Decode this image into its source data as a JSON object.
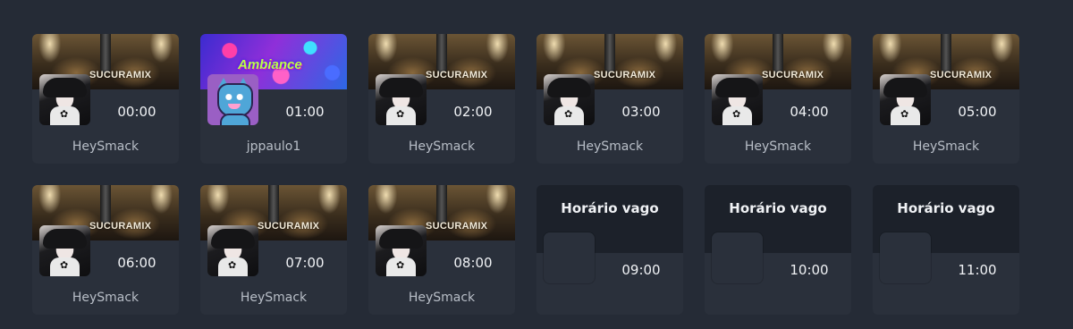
{
  "slots": [
    {
      "time": "00:00",
      "user": "HeySmack",
      "banner": "studio",
      "brand": "SUCURAMIX",
      "avatar": "anime-avatar"
    },
    {
      "time": "01:00",
      "user": "jppaulo1",
      "banner": "neon",
      "brand": "Ambiance",
      "avatar": "cat-avatar"
    },
    {
      "time": "02:00",
      "user": "HeySmack",
      "banner": "studio",
      "brand": "SUCURAMIX",
      "avatar": "anime-avatar"
    },
    {
      "time": "03:00",
      "user": "HeySmack",
      "banner": "studio",
      "brand": "SUCURAMIX",
      "avatar": "anime-avatar"
    },
    {
      "time": "04:00",
      "user": "HeySmack",
      "banner": "studio",
      "brand": "SUCURAMIX",
      "avatar": "anime-avatar"
    },
    {
      "time": "05:00",
      "user": "HeySmack",
      "banner": "studio",
      "brand": "SUCURAMIX",
      "avatar": "anime-avatar"
    },
    {
      "time": "06:00",
      "user": "HeySmack",
      "banner": "studio",
      "brand": "SUCURAMIX",
      "avatar": "anime-avatar"
    },
    {
      "time": "07:00",
      "user": "HeySmack",
      "banner": "studio",
      "brand": "SUCURAMIX",
      "avatar": "anime-avatar"
    },
    {
      "time": "08:00",
      "user": "HeySmack",
      "banner": "studio",
      "brand": "SUCURAMIX",
      "avatar": "anime-avatar"
    },
    {
      "time": "09:00",
      "vacant_label": "Horário vago"
    },
    {
      "time": "10:00",
      "vacant_label": "Horário vago"
    },
    {
      "time": "11:00",
      "vacant_label": "Horário vago"
    }
  ],
  "colors": {
    "background": "#252b36",
    "card": "#2a303b",
    "vacant_header": "#1c212a",
    "time_text": "#f0f2f5",
    "user_text": "#b8bec7"
  }
}
